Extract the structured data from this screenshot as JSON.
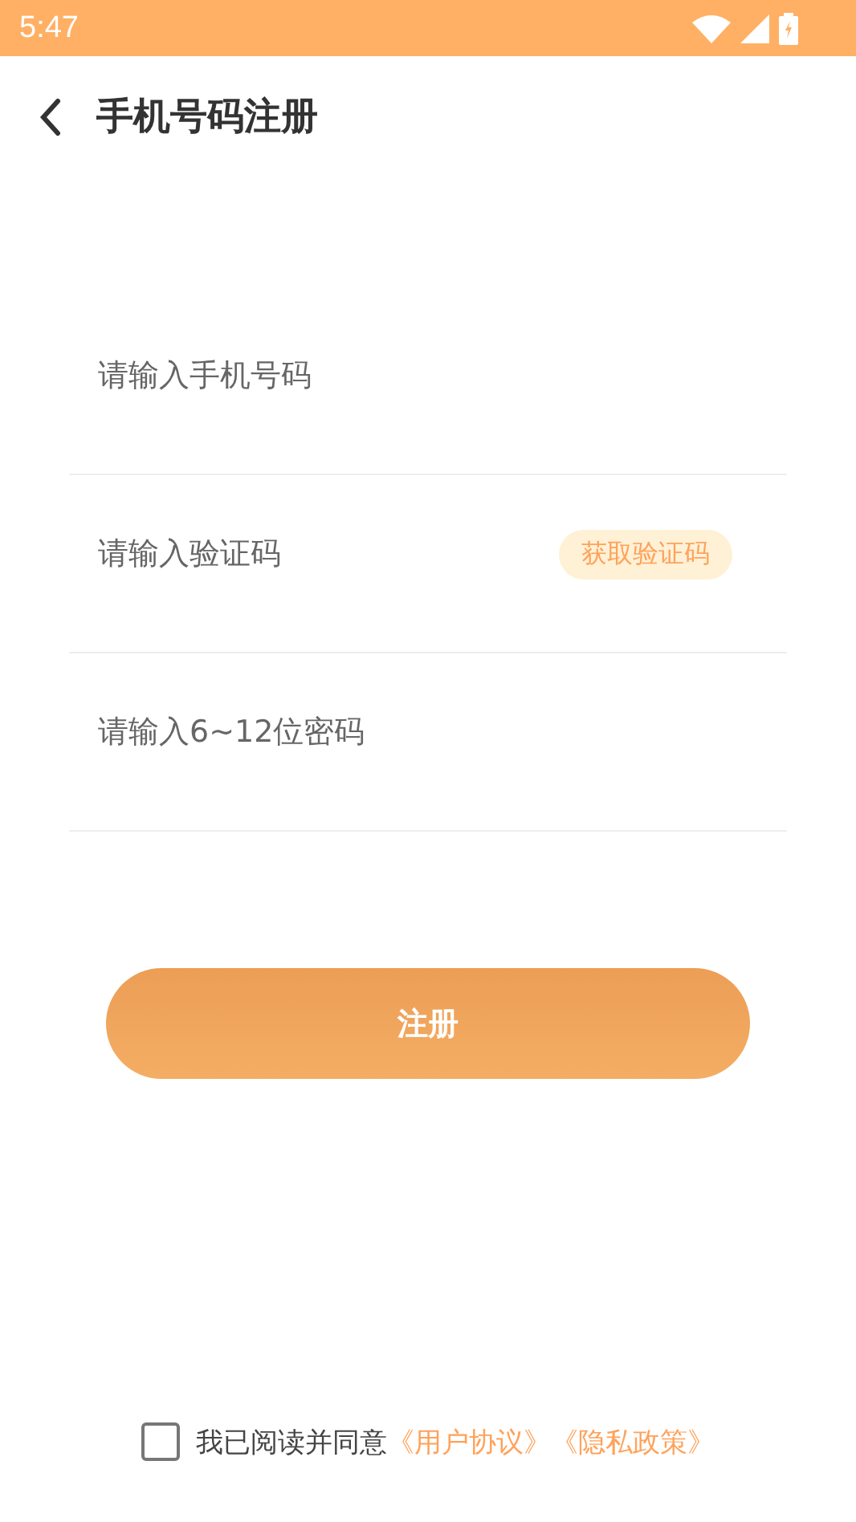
{
  "status_bar": {
    "time": "5:47"
  },
  "header": {
    "title": "手机号码注册"
  },
  "fields": [
    {
      "placeholder": "请输入手机号码"
    },
    {
      "placeholder": "请输入验证码",
      "action": "获取验证码"
    },
    {
      "placeholder": "请输入6~12位密码"
    }
  ],
  "submit": "注册",
  "agreement": {
    "checked": false,
    "text": "我已阅读并同意",
    "links": [
      "《用户协议》",
      "《隐私政策》"
    ]
  }
}
